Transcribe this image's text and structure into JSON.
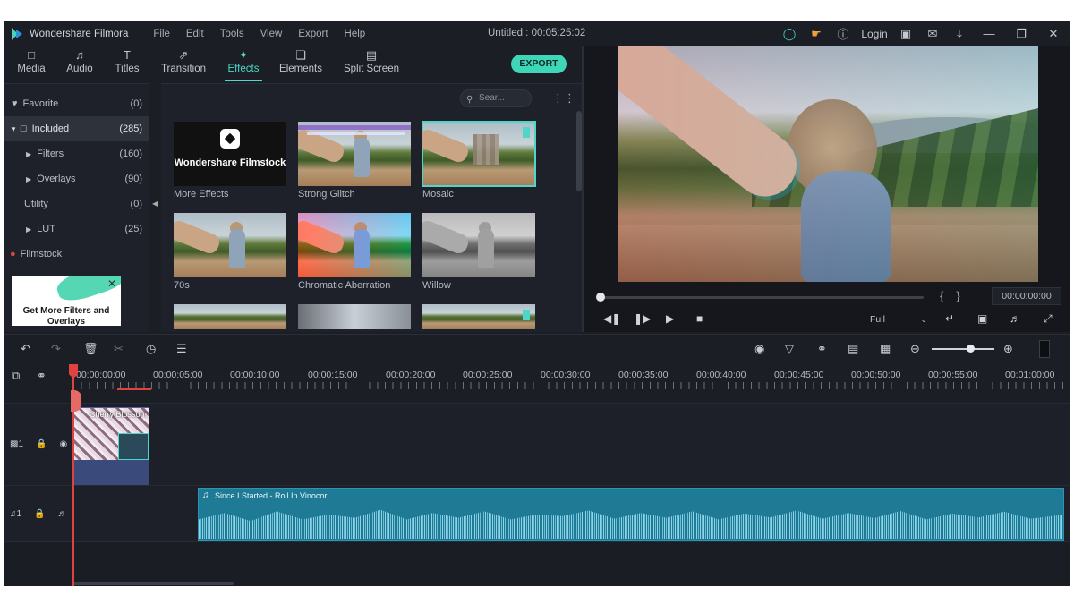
{
  "app": {
    "title": "Wondershare Filmora",
    "document_title": "Untitled : 00:05:25:02",
    "menu": [
      "File",
      "Edit",
      "Tools",
      "View",
      "Export",
      "Help"
    ],
    "login_label": "Login"
  },
  "tabs": [
    {
      "label": "Media",
      "icon": "folder-icon"
    },
    {
      "label": "Audio",
      "icon": "music-note-icon"
    },
    {
      "label": "Titles",
      "icon": "text-icon"
    },
    {
      "label": "Transition",
      "icon": "transition-icon"
    },
    {
      "label": "Effects",
      "icon": "effects-icon",
      "active": true
    },
    {
      "label": "Elements",
      "icon": "elements-icon"
    },
    {
      "label": "Split Screen",
      "icon": "split-screen-icon"
    }
  ],
  "export_label": "EXPORT",
  "library": {
    "items": [
      {
        "label": "Favorite",
        "count": "(0)"
      },
      {
        "label": "Included",
        "count": "(285)",
        "selected": true
      },
      {
        "label": "Filters",
        "count": "(160)"
      },
      {
        "label": "Overlays",
        "count": "(90)"
      },
      {
        "label": "Utility",
        "count": "(0)"
      },
      {
        "label": "LUT",
        "count": "(25)"
      },
      {
        "label": "Filmstock",
        "count": ""
      }
    ],
    "promo_text": "Get More Filters and Overlays"
  },
  "search": {
    "placeholder": "Sear..."
  },
  "effects": [
    {
      "label": "More Effects",
      "thumb_text": "Wondershare Filmstock"
    },
    {
      "label": "Strong Glitch"
    },
    {
      "label": "Mosaic",
      "selected": true
    },
    {
      "label": "70s"
    },
    {
      "label": "Chromatic Aberration"
    },
    {
      "label": "Willow"
    }
  ],
  "preview": {
    "timecode": "00:00:00:00",
    "quality": "Full",
    "progress": 0.0
  },
  "timeline": {
    "ruler": [
      "00:00:00:00",
      "00:00:05:00",
      "00:00:10:00",
      "00:00:15:00",
      "00:00:20:00",
      "00:00:25:00",
      "00:00:30:00",
      "00:00:35:00",
      "00:00:40:00",
      "00:00:45:00",
      "00:00:50:00",
      "00:00:55:00",
      "00:01:00:00"
    ],
    "video_track_label": "1",
    "audio_track_label": "1",
    "video_clip_name": "Cherry Blossom",
    "audio_clip_name": "Since I Started - Roll In Vinocor"
  }
}
